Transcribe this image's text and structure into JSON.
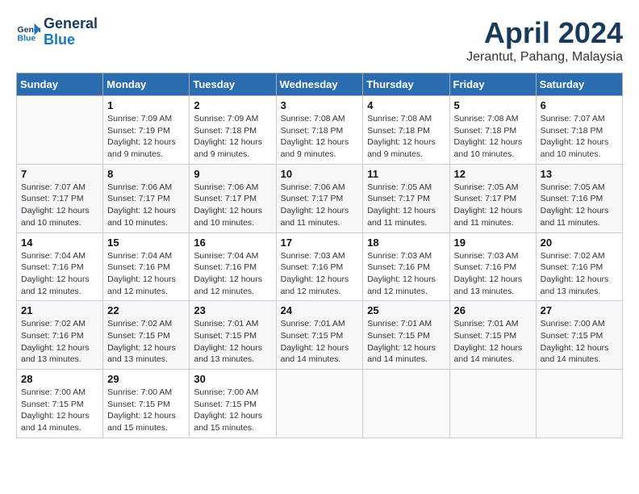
{
  "header": {
    "logo_line1": "General",
    "logo_line2": "Blue",
    "month": "April 2024",
    "location": "Jerantut, Pahang, Malaysia"
  },
  "weekdays": [
    "Sunday",
    "Monday",
    "Tuesday",
    "Wednesday",
    "Thursday",
    "Friday",
    "Saturday"
  ],
  "weeks": [
    [
      {
        "day": "",
        "info": ""
      },
      {
        "day": "1",
        "info": "Sunrise: 7:09 AM\nSunset: 7:19 PM\nDaylight: 12 hours\nand 9 minutes."
      },
      {
        "day": "2",
        "info": "Sunrise: 7:09 AM\nSunset: 7:18 PM\nDaylight: 12 hours\nand 9 minutes."
      },
      {
        "day": "3",
        "info": "Sunrise: 7:08 AM\nSunset: 7:18 PM\nDaylight: 12 hours\nand 9 minutes."
      },
      {
        "day": "4",
        "info": "Sunrise: 7:08 AM\nSunset: 7:18 PM\nDaylight: 12 hours\nand 9 minutes."
      },
      {
        "day": "5",
        "info": "Sunrise: 7:08 AM\nSunset: 7:18 PM\nDaylight: 12 hours\nand 10 minutes."
      },
      {
        "day": "6",
        "info": "Sunrise: 7:07 AM\nSunset: 7:18 PM\nDaylight: 12 hours\nand 10 minutes."
      }
    ],
    [
      {
        "day": "7",
        "info": "Sunrise: 7:07 AM\nSunset: 7:17 PM\nDaylight: 12 hours\nand 10 minutes."
      },
      {
        "day": "8",
        "info": "Sunrise: 7:06 AM\nSunset: 7:17 PM\nDaylight: 12 hours\nand 10 minutes."
      },
      {
        "day": "9",
        "info": "Sunrise: 7:06 AM\nSunset: 7:17 PM\nDaylight: 12 hours\nand 10 minutes."
      },
      {
        "day": "10",
        "info": "Sunrise: 7:06 AM\nSunset: 7:17 PM\nDaylight: 12 hours\nand 11 minutes."
      },
      {
        "day": "11",
        "info": "Sunrise: 7:05 AM\nSunset: 7:17 PM\nDaylight: 12 hours\nand 11 minutes."
      },
      {
        "day": "12",
        "info": "Sunrise: 7:05 AM\nSunset: 7:17 PM\nDaylight: 12 hours\nand 11 minutes."
      },
      {
        "day": "13",
        "info": "Sunrise: 7:05 AM\nSunset: 7:16 PM\nDaylight: 12 hours\nand 11 minutes."
      }
    ],
    [
      {
        "day": "14",
        "info": "Sunrise: 7:04 AM\nSunset: 7:16 PM\nDaylight: 12 hours\nand 12 minutes."
      },
      {
        "day": "15",
        "info": "Sunrise: 7:04 AM\nSunset: 7:16 PM\nDaylight: 12 hours\nand 12 minutes."
      },
      {
        "day": "16",
        "info": "Sunrise: 7:04 AM\nSunset: 7:16 PM\nDaylight: 12 hours\nand 12 minutes."
      },
      {
        "day": "17",
        "info": "Sunrise: 7:03 AM\nSunset: 7:16 PM\nDaylight: 12 hours\nand 12 minutes."
      },
      {
        "day": "18",
        "info": "Sunrise: 7:03 AM\nSunset: 7:16 PM\nDaylight: 12 hours\nand 12 minutes."
      },
      {
        "day": "19",
        "info": "Sunrise: 7:03 AM\nSunset: 7:16 PM\nDaylight: 12 hours\nand 13 minutes."
      },
      {
        "day": "20",
        "info": "Sunrise: 7:02 AM\nSunset: 7:16 PM\nDaylight: 12 hours\nand 13 minutes."
      }
    ],
    [
      {
        "day": "21",
        "info": "Sunrise: 7:02 AM\nSunset: 7:16 PM\nDaylight: 12 hours\nand 13 minutes."
      },
      {
        "day": "22",
        "info": "Sunrise: 7:02 AM\nSunset: 7:15 PM\nDaylight: 12 hours\nand 13 minutes."
      },
      {
        "day": "23",
        "info": "Sunrise: 7:01 AM\nSunset: 7:15 PM\nDaylight: 12 hours\nand 13 minutes."
      },
      {
        "day": "24",
        "info": "Sunrise: 7:01 AM\nSunset: 7:15 PM\nDaylight: 12 hours\nand 14 minutes."
      },
      {
        "day": "25",
        "info": "Sunrise: 7:01 AM\nSunset: 7:15 PM\nDaylight: 12 hours\nand 14 minutes."
      },
      {
        "day": "26",
        "info": "Sunrise: 7:01 AM\nSunset: 7:15 PM\nDaylight: 12 hours\nand 14 minutes."
      },
      {
        "day": "27",
        "info": "Sunrise: 7:00 AM\nSunset: 7:15 PM\nDaylight: 12 hours\nand 14 minutes."
      }
    ],
    [
      {
        "day": "28",
        "info": "Sunrise: 7:00 AM\nSunset: 7:15 PM\nDaylight: 12 hours\nand 14 minutes."
      },
      {
        "day": "29",
        "info": "Sunrise: 7:00 AM\nSunset: 7:15 PM\nDaylight: 12 hours\nand 15 minutes."
      },
      {
        "day": "30",
        "info": "Sunrise: 7:00 AM\nSunset: 7:15 PM\nDaylight: 12 hours\nand 15 minutes."
      },
      {
        "day": "",
        "info": ""
      },
      {
        "day": "",
        "info": ""
      },
      {
        "day": "",
        "info": ""
      },
      {
        "day": "",
        "info": ""
      }
    ]
  ]
}
